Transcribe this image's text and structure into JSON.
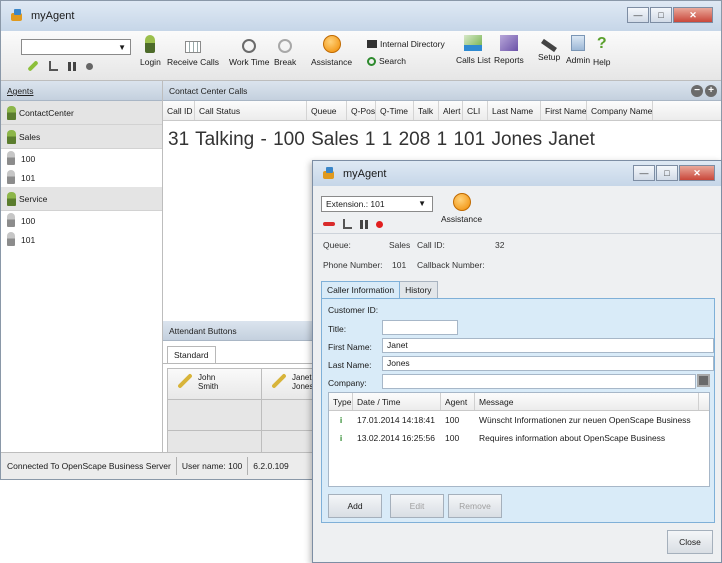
{
  "main": {
    "title": "myAgent",
    "toolbar": {
      "login": "Login",
      "receive_calls": "Receive Calls",
      "work_time": "Work Time",
      "break": "Break",
      "assistance": "Assistance",
      "internal_directory": "Internal Directory",
      "search": "Search",
      "calls_list": "Calls List",
      "reports": "Reports",
      "setup": "Setup",
      "admin": "Admin",
      "help": "Help"
    },
    "agents": {
      "header": "Agents",
      "groups": [
        {
          "name": "ContactCenter",
          "agents": []
        },
        {
          "name": "Sales",
          "agents": [
            "100",
            "101"
          ]
        },
        {
          "name": "Service",
          "agents": [
            "100",
            "101"
          ]
        }
      ]
    },
    "contact_center": {
      "header": "Contact Center Calls",
      "columns": [
        "Call ID",
        "Call Status",
        "Queue",
        "Q-Pos",
        "Q-Time",
        "Talk",
        "Alert",
        "CLI",
        "Last Name",
        "First Name",
        "Company Name"
      ],
      "row": {
        "call_id": "31",
        "status": "Talking - 100",
        "queue": "Sales 1",
        "qpos": "1",
        "qtime": "208",
        "talk": "1",
        "cli": "101",
        "last": "Jones",
        "first": "Janet"
      }
    },
    "attendant": {
      "header": "Attendant Buttons",
      "tab": "Standard",
      "buttons": [
        {
          "first": "John",
          "last": "Smith"
        },
        {
          "first": "Janet",
          "last": "Jones"
        }
      ]
    },
    "status": {
      "server": "Connected To OpenScape Business Server",
      "user": "User name: 100",
      "version": "6.2.0.109"
    }
  },
  "dialog": {
    "title": "myAgent",
    "extension": "Extension.: 101",
    "assistance": "Assistance",
    "queue_label": "Queue:",
    "queue_value": "Sales",
    "call_id_label": "Call ID:",
    "call_id_value": "32",
    "phone_label": "Phone Number:",
    "phone_value": "101",
    "callback_label": "Callback Number:",
    "tabs": [
      "Caller Information",
      "History"
    ],
    "form": {
      "customer_id_label": "Customer ID:",
      "title_label": "Title:",
      "title_value": "",
      "first_name_label": "First Name:",
      "first_name_value": "Janet",
      "last_name_label": "Last Name:",
      "last_name_value": "Jones",
      "company_label": "Company:",
      "company_value": ""
    },
    "history": {
      "columns": [
        "Type",
        "Date / Time",
        "Agent",
        "Message"
      ],
      "rows": [
        {
          "type": "i",
          "datetime": "17.01.2014 14:18:41",
          "agent": "100",
          "message": "Wünscht Informationen zur neuen OpenScape Business"
        },
        {
          "type": "i",
          "datetime": "13.02.2014 16:25:56",
          "agent": "100",
          "message": "Requires information about OpenScape Business"
        }
      ]
    },
    "buttons": {
      "add": "Add",
      "edit": "Edit",
      "remove": "Remove",
      "close": "Close"
    }
  }
}
